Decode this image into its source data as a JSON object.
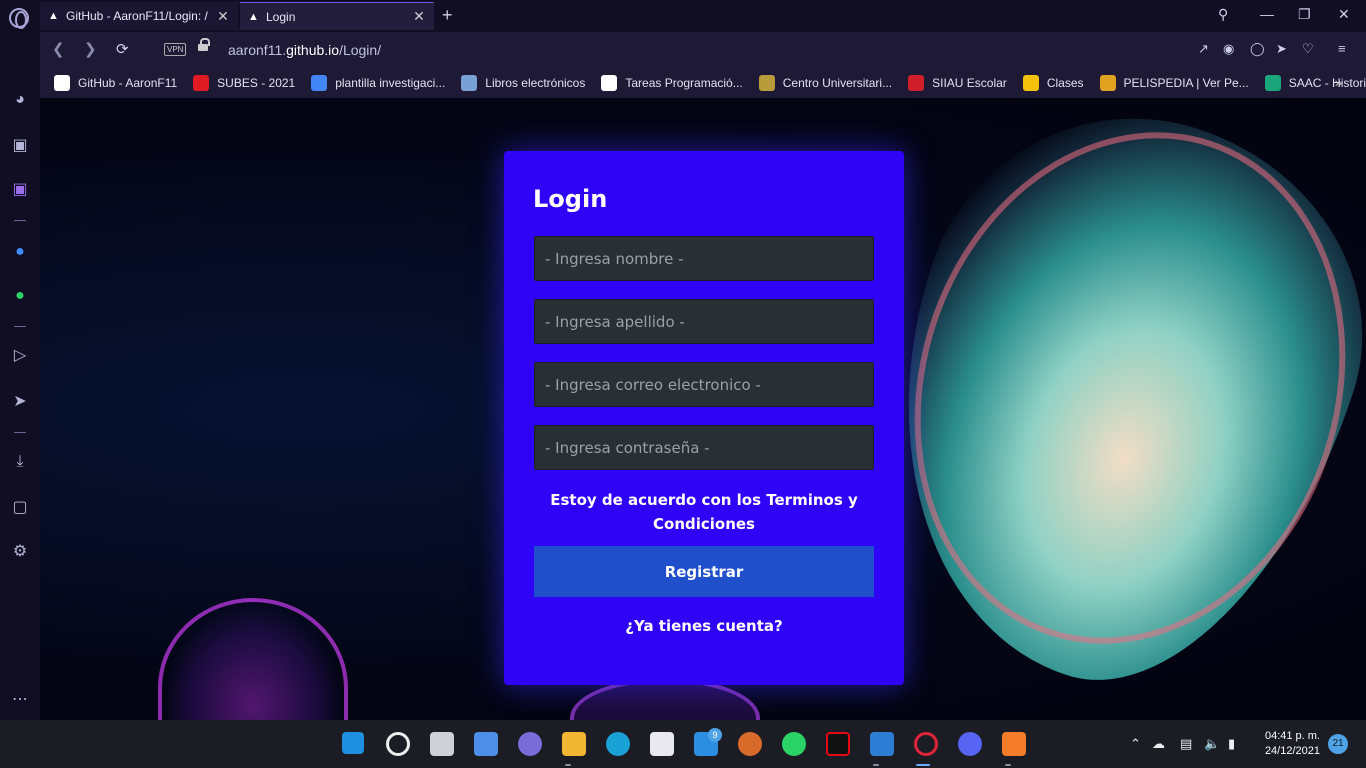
{
  "browser": {
    "tabs": [
      {
        "label": "GitHub - AaronF11/Login: /",
        "icon": "github-incognito-icon"
      },
      {
        "label": "Login",
        "icon": "incognito-icon"
      }
    ],
    "url_prefix": "aaronf11.",
    "url_domain": "github.io",
    "url_path": "/Login/",
    "vpn_label": "VPN",
    "bookmarks": [
      {
        "label": "GitHub - AaronF11",
        "color": "#ffffff"
      },
      {
        "label": "SUBES - 2021",
        "color": "#e01b24"
      },
      {
        "label": "plantilla investigaci...",
        "color": "#4285f4"
      },
      {
        "label": "Libros electrónicos",
        "color": "#7aa0d8"
      },
      {
        "label": "Tareas Programació...",
        "color": "#ffffff"
      },
      {
        "label": "Centro Universitari...",
        "color": "#b89b3a"
      },
      {
        "label": "SIIAU Escolar",
        "color": "#d01f2b"
      },
      {
        "label": "Clases",
        "color": "#f4c20d"
      },
      {
        "label": "PELISPEDIA | Ver Pe...",
        "color": "#e0a020"
      },
      {
        "label": "SAAC - Historial",
        "color": "#1aa67a"
      }
    ]
  },
  "login": {
    "title": "Login",
    "fields": {
      "nombre_placeholder": "- Ingresa nombre -",
      "apellido_placeholder": "- Ingresa apellido -",
      "correo_placeholder": "- Ingresa correo electronico -",
      "contrasena_placeholder": "- Ingresa contraseña -"
    },
    "terms": "Estoy de acuerdo con los Terminos y Condiciones",
    "submit_label": "Registrar",
    "have_account": "¿Ya tienes cuenta?"
  },
  "taskbar": {
    "time": "04:41 p. m.",
    "date": "24/12/2021",
    "notifications": "21",
    "mail_badge": "9"
  }
}
